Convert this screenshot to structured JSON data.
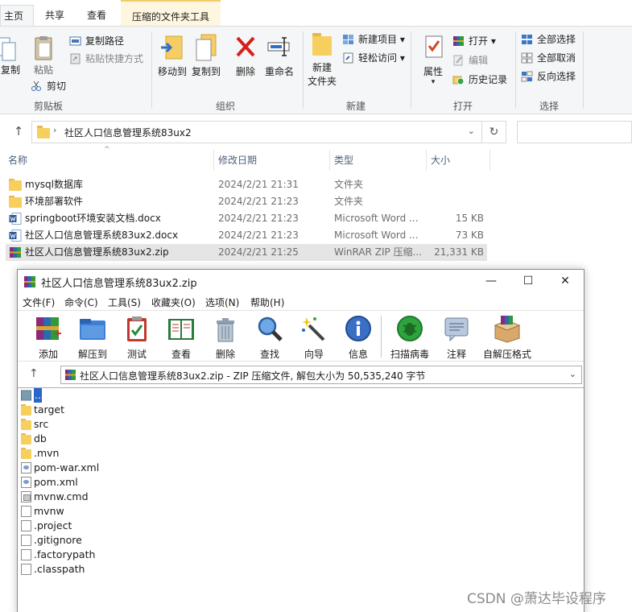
{
  "explorer": {
    "tabs": [
      "主页",
      "共享",
      "查看",
      "压缩的文件夹工具"
    ],
    "ribbon": {
      "clipboard": {
        "label": "剪贴板",
        "copy": "复制",
        "paste": "粘贴",
        "copy_path": "复制路径",
        "paste_shortcut": "粘贴快捷方式",
        "cut": "剪切"
      },
      "organize": {
        "label": "组织",
        "move_to": "移动到",
        "copy_to": "复制到",
        "delete": "删除",
        "rename": "重命名"
      },
      "new": {
        "label": "新建",
        "new_folder_l1": "新建",
        "new_folder_l2": "文件夹",
        "new_item": "新建项目",
        "easy_access": "轻松访问"
      },
      "open": {
        "label": "打开",
        "properties": "属性",
        "open": "打开",
        "edit": "编辑",
        "history": "历史记录"
      },
      "select": {
        "label": "选择",
        "select_all": "全部选择",
        "select_none": "全部取消",
        "invert": "反向选择"
      }
    },
    "address": "社区人口信息管理系统83ux2",
    "columns": [
      "名称",
      "修改日期",
      "类型",
      "大小"
    ],
    "files": [
      {
        "name": "mysql数据库",
        "date": "2024/2/21 21:31",
        "type": "文件夹",
        "size": "",
        "icon": "folder-icon"
      },
      {
        "name": "环境部署软件",
        "date": "2024/2/21 21:23",
        "type": "文件夹",
        "size": "",
        "icon": "folder-icon"
      },
      {
        "name": "springboot环境安装文档.docx",
        "date": "2024/2/21 21:23",
        "type": "Microsoft Word ...",
        "size": "15 KB",
        "icon": "word-icon"
      },
      {
        "name": "社区人口信息管理系统83ux2.docx",
        "date": "2024/2/21 21:23",
        "type": "Microsoft Word ...",
        "size": "73 KB",
        "icon": "word-icon"
      },
      {
        "name": "社区人口信息管理系统83ux2.zip",
        "date": "2024/2/21 21:25",
        "type": "WinRAR ZIP 压缩...",
        "size": "21,331 KB",
        "icon": "winrar-icon"
      }
    ]
  },
  "winrar": {
    "title": "社区人口信息管理系统83ux2.zip",
    "menu": [
      "文件(F)",
      "命令(C)",
      "工具(S)",
      "收藏夹(O)",
      "选项(N)",
      "帮助(H)"
    ],
    "toolbar": [
      "添加",
      "解压到",
      "测试",
      "查看",
      "删除",
      "查找",
      "向导",
      "信息",
      "扫描病毒",
      "注释",
      "自解压格式"
    ],
    "path": "社区人口信息管理系统83ux2.zip - ZIP 压缩文件, 解包大小为 50,535,240 字节",
    "entries": [
      {
        "name": "..",
        "icon": "parent-folder-icon"
      },
      {
        "name": "target",
        "icon": "folder-icon"
      },
      {
        "name": "src",
        "icon": "folder-icon"
      },
      {
        "name": "db",
        "icon": "folder-icon"
      },
      {
        "name": ".mvn",
        "icon": "folder-icon"
      },
      {
        "name": "pom-war.xml",
        "icon": "xml-file-icon"
      },
      {
        "name": "pom.xml",
        "icon": "xml-file-icon"
      },
      {
        "name": "mvnw.cmd",
        "icon": "cmd-file-icon"
      },
      {
        "name": "mvnw",
        "icon": "file-icon"
      },
      {
        "name": ".project",
        "icon": "file-icon"
      },
      {
        "name": ".gitignore",
        "icon": "file-icon"
      },
      {
        "name": ".factorypath",
        "icon": "file-icon"
      },
      {
        "name": ".classpath",
        "icon": "file-icon"
      }
    ]
  },
  "watermark": "CSDN @萧达毕设程序"
}
